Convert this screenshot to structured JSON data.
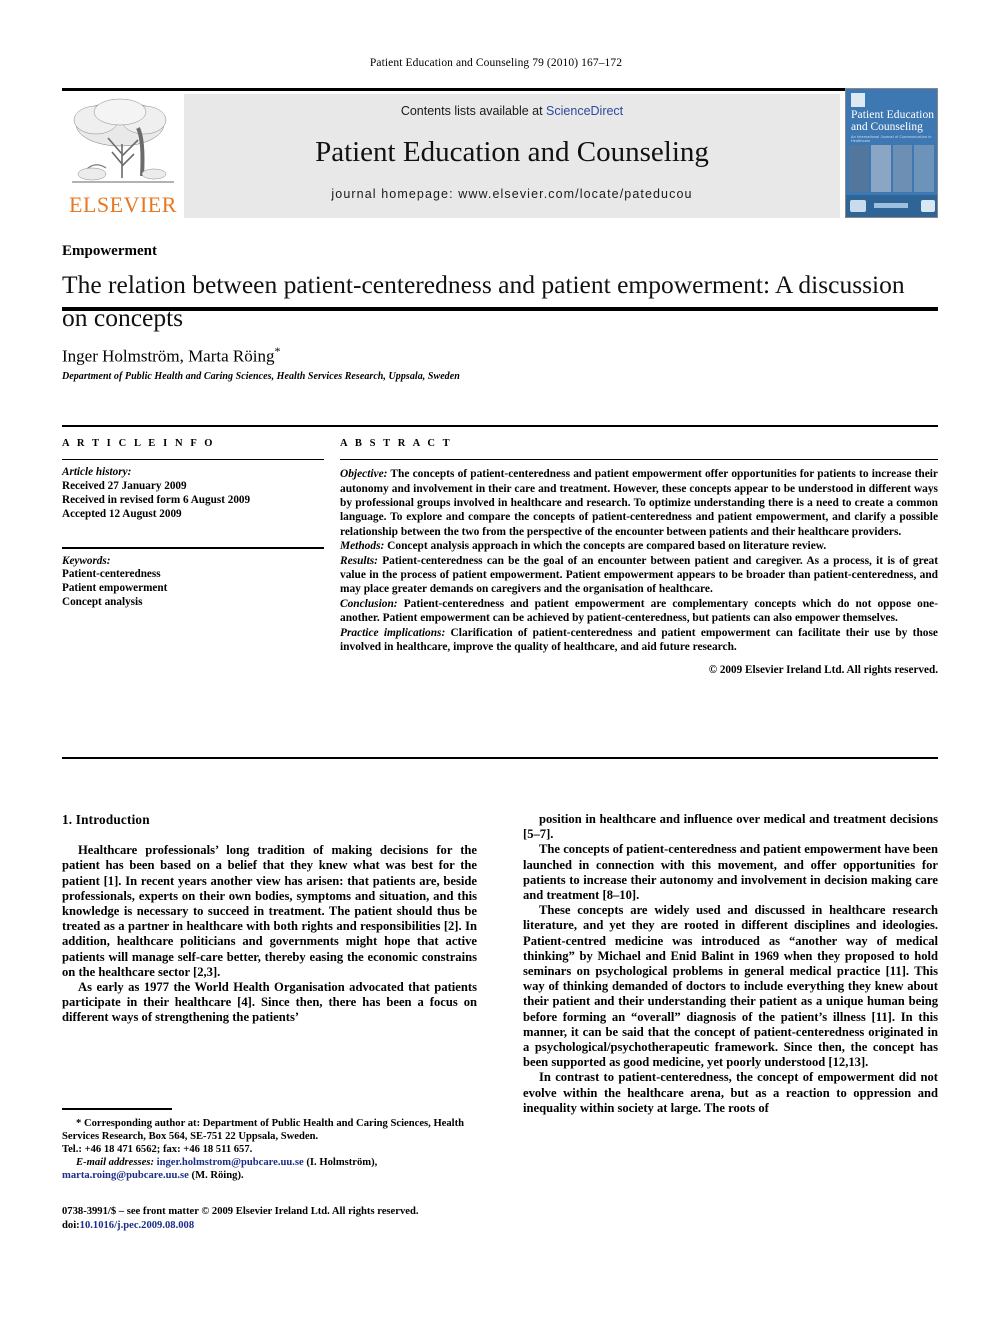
{
  "running_head": "Patient Education and Counseling 79 (2010) 167–172",
  "masthead": {
    "contents_prefix": "Contents lists available at ",
    "contents_link": "ScienceDirect",
    "journal_title": "Patient Education and Counseling",
    "homepage": "journal homepage: www.elsevier.com/locate/pateducou",
    "publisher_wordmark": "ELSEVIER",
    "cover": {
      "line1": "Patient Education",
      "line2": "and Counseling",
      "subtitle": "An International Journal of Communication in Healthcare"
    }
  },
  "article": {
    "section_label": "Empowerment",
    "title": "The relation between patient-centeredness and patient empowerment: A discussion on concepts",
    "authors": "Inger Holmström, Marta Röing",
    "corresponding_marker": "*",
    "affiliation": "Department of Public Health and Caring Sciences, Health Services Research, Uppsala, Sweden"
  },
  "article_info": {
    "heading": "A R T I C L E   I N F O",
    "history_label": "Article history:",
    "history": [
      "Received 27 January 2009",
      "Received in revised form 6 August 2009",
      "Accepted 12 August 2009"
    ],
    "keywords_label": "Keywords:",
    "keywords": [
      "Patient-centeredness",
      "Patient empowerment",
      "Concept analysis"
    ]
  },
  "abstract": {
    "heading": "A B S T R A C T",
    "objective_label": "Objective:",
    "objective_text": " The concepts of patient-centeredness and patient empowerment offer opportunities for patients to increase their autonomy and involvement in their care and treatment. However, these concepts appear to be understood in different ways by professional groups involved in healthcare and research. To optimize understanding there is a need to create a common language. To explore and compare the concepts of patient-centeredness and patient empowerment, and clarify a possible relationship between the two from the perspective of the encounter between patients and their healthcare providers.",
    "methods_label": "Methods:",
    "methods_text": " Concept analysis approach in which the concepts are compared based on literature review.",
    "results_label": "Results:",
    "results_text": " Patient-centeredness can be the goal of an encounter between patient and caregiver. As a process, it is of great value in the process of patient empowerment. Patient empowerment appears to be broader than patient-centeredness, and may place greater demands on caregivers and the organisation of healthcare.",
    "conclusion_label": "Conclusion:",
    "conclusion_text": " Patient-centeredness and patient empowerment are complementary concepts which do not oppose one-another. Patient empowerment can be achieved by patient-centeredness, but patients can also empower themselves.",
    "practice_label": "Practice implications:",
    "practice_text": " Clarification of patient-centeredness and patient empowerment can facilitate their use by those involved in healthcare, improve the quality of healthcare, and aid future research.",
    "copyright": "© 2009 Elsevier Ireland Ltd. All rights reserved."
  },
  "body": {
    "section_heading": "1. Introduction",
    "left_paragraphs": [
      "Healthcare professionals’ long tradition of making decisions for the patient has been based on a belief that they knew what was best for the patient [1]. In recent years another view has arisen: that patients are, beside professionals, experts on their own bodies, symptoms and situation, and this knowledge is necessary to succeed in treatment. The patient should thus be treated as a partner in healthcare with both rights and responsibilities [2]. In addition, healthcare politicians and governments might hope that active patients will manage self-care better, thereby easing the economic constrains on the healthcare sector [2,3].",
      "As early as 1977 the World Health Organisation advocated that patients participate in their healthcare [4]. Since then, there has been a focus on different ways of strengthening the patients’"
    ],
    "right_paragraphs": [
      "position in healthcare and influence over medical and treatment decisions [5–7].",
      "The concepts of patient-centeredness and patient empowerment have been launched in connection with this movement, and offer opportunities for patients to increase their autonomy and involvement in decision making care and treatment [8–10].",
      "These concepts are widely used and discussed in healthcare research literature, and yet they are rooted in different disciplines and ideologies. Patient-centred medicine was introduced as “another way of medical thinking” by Michael and Enid Balint in 1969 when they proposed to hold seminars on psychological problems in general medical practice [11]. This way of thinking demanded of doctors to include everything they knew about their patient and their understanding their patient as a unique human being before forming an “overall” diagnosis of the patient’s illness [11]. In this manner, it can be said that the concept of patient-centeredness originated in a psychological/psychotherapeutic framework. Since then, the concept has been supported as good medicine, yet poorly understood [12,13].",
      "In contrast to patient-centeredness, the concept of empowerment did not evolve within the healthcare arena, but as a reaction to oppression and inequality within society at large. The roots of"
    ]
  },
  "footnote": {
    "marker": "*",
    "corresponding": " Corresponding author at: Department of Public Health and Caring Sciences, Health Services Research, Box 564, SE-751 22 Uppsala, Sweden.",
    "tel": "Tel.: +46 18 471 6562; fax: +46 18 511 657.",
    "email_label": "E-mail addresses:",
    "email1": "inger.holmstrom@pubcare.uu.se",
    "email1_name": " (I. Holmström),",
    "email2": "marta.roing@pubcare.uu.se",
    "email2_name": " (M. Röing)."
  },
  "imprint": {
    "line1": "0738-3991/$ – see front matter © 2009 Elsevier Ireland Ltd. All rights reserved.",
    "doi_label": "doi:",
    "doi": "10.1016/j.pec.2009.08.008"
  }
}
